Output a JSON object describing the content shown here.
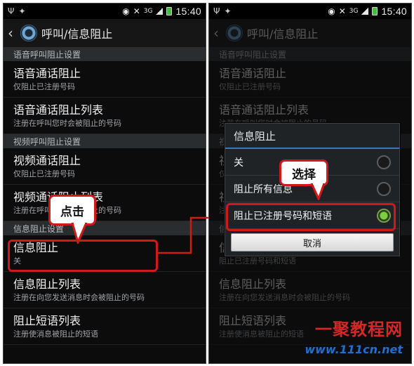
{
  "status_bar": {
    "time": "15:40",
    "network": "3G"
  },
  "left": {
    "title": "呼叫/信息阻止",
    "sections": [
      {
        "header": "语音呼叫阻止设置"
      },
      {
        "header": "视频呼叫阻止设置"
      },
      {
        "header": "信息阻止设置"
      }
    ],
    "items": [
      {
        "title": "语音通话阻止",
        "subtitle": "仅阻止已注册号码"
      },
      {
        "title": "语音通话阻止列表",
        "subtitle": "注册在呼叫您时会被阻止的号码"
      },
      {
        "title": "视频通话阻止",
        "subtitle": "仅阻止已注册号码"
      },
      {
        "title": "视频通话阻止列表",
        "subtitle": "注册在呼叫您时会被阻止的号码"
      },
      {
        "title": "信息阻止",
        "subtitle": "关"
      },
      {
        "title": "信息阻止列表",
        "subtitle": "注册在向您发送消息时会被阻止的号码"
      },
      {
        "title": "阻止短语列表",
        "subtitle": "注册使消息被阻止的短语"
      }
    ],
    "callout": "点击"
  },
  "right": {
    "title": "呼叫/信息阻止",
    "dialog": {
      "title": "信息阻止",
      "options": [
        {
          "label": "关",
          "selected": false
        },
        {
          "label": "阻止所有信息",
          "selected": false
        },
        {
          "label": "阻止已注册号码和短语",
          "selected": true
        }
      ],
      "cancel_label": "取消"
    },
    "behind_subtitle": "阻止已注册号码和短语",
    "callout": "选择"
  },
  "watermark": {
    "brand": "一聚教程网",
    "url": "www.111cn.net"
  },
  "colors": {
    "accent_red": "#d01a1a",
    "selected_green": "#7bd241",
    "dialog_divider": "#3a78b8"
  }
}
